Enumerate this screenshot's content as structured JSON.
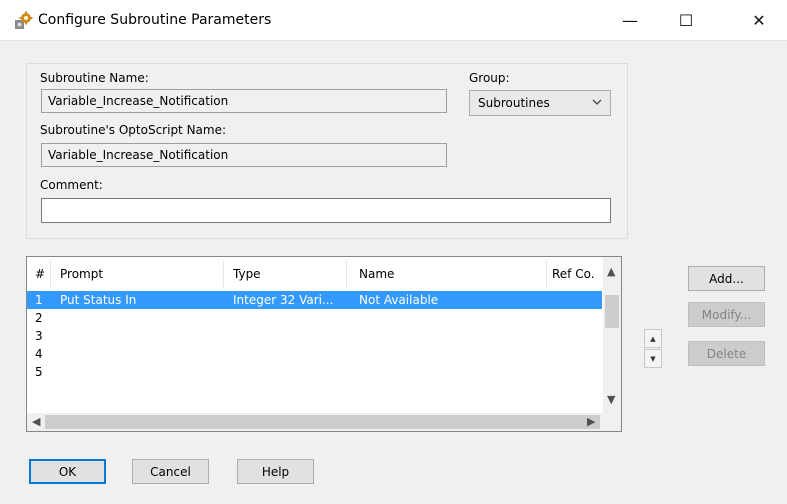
{
  "window": {
    "title": "Configure Subroutine Parameters",
    "controls": {
      "minimize": "—",
      "maximize": "☐",
      "close": "✕"
    }
  },
  "form": {
    "subroutine_name_label": "Subroutine Name:",
    "subroutine_name_value": "Variable_Increase_Notification",
    "group_label": "Group:",
    "group_value": "Subroutines",
    "optoscript_name_label": "Subroutine's OptoScript Name:",
    "optoscript_name_value": "Variable_Increase_Notification",
    "comment_label": "Comment:",
    "comment_value": ""
  },
  "grid": {
    "columns": [
      "#",
      "Prompt",
      "Type",
      "Name",
      "Ref Co."
    ],
    "rows": [
      {
        "num": "1",
        "prompt": "Put Status In",
        "type": "Integer 32 Vari...",
        "name": "Not Available",
        "ref": "",
        "selected": true
      },
      {
        "num": "2",
        "prompt": "",
        "type": "",
        "name": "",
        "ref": "",
        "selected": false
      },
      {
        "num": "3",
        "prompt": "",
        "type": "",
        "name": "",
        "ref": "",
        "selected": false
      },
      {
        "num": "4",
        "prompt": "",
        "type": "",
        "name": "",
        "ref": "",
        "selected": false
      },
      {
        "num": "5",
        "prompt": "",
        "type": "",
        "name": "",
        "ref": "",
        "selected": false
      }
    ]
  },
  "side_buttons": {
    "add": "Add...",
    "modify": "Modify...",
    "delete": "Delete"
  },
  "footer_buttons": {
    "ok": "OK",
    "cancel": "Cancel",
    "help": "Help"
  },
  "icons": {
    "app": "gear-icon",
    "move_up": "arrow-up-icon",
    "move_down": "arrow-down-icon"
  },
  "colors": {
    "selection": "#3399ff",
    "default_button_border": "#0078d7",
    "window_bg": "#f0f0f0"
  }
}
